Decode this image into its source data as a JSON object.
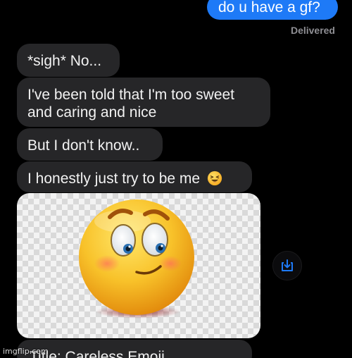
{
  "conversation": {
    "sent_message": "do u have a gf?",
    "delivery_status": "Delivered",
    "received_messages": [
      "*sigh* No...",
      "I've been told that I'm too sweet and caring and nice",
      "But I don't know..",
      "I honestly just try to be me"
    ],
    "image_caption": "Title: Careless Emoji"
  },
  "icons": {
    "inline_emoji": "laughing-squinting-face-emoji",
    "image_content": "shy-smiling-face-emoji",
    "save_button_icon": "download-to-tray-icon"
  },
  "watermark": "imgflip.com",
  "colors": {
    "background": "#000000",
    "outgoing_bubble": "#1e7af7",
    "incoming_bubble": "#262628",
    "status_text": "#8e8e93",
    "accent": "#1e7af7"
  }
}
